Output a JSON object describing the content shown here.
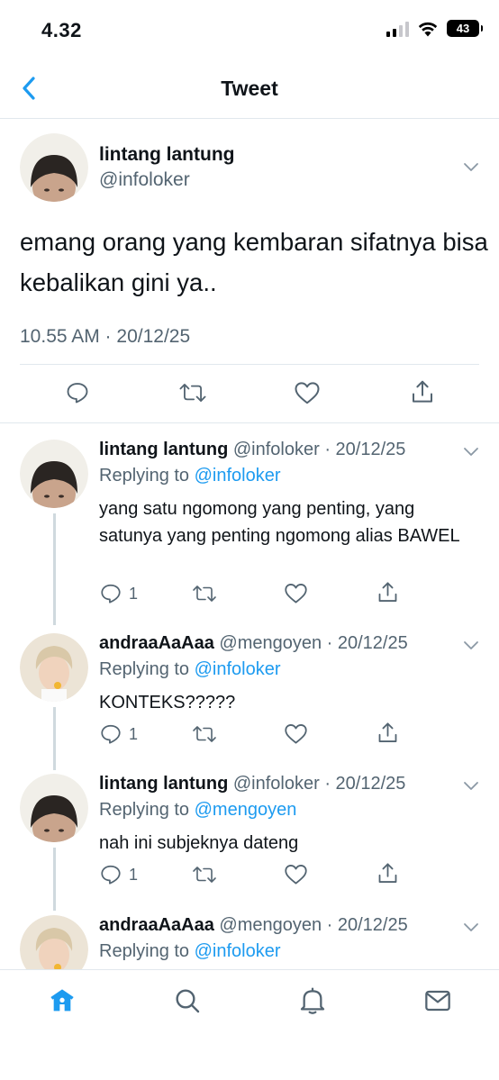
{
  "status_bar": {
    "time": "4.32",
    "battery": "43"
  },
  "header": {
    "title": "Tweet"
  },
  "main_tweet": {
    "name": "lintang lantung",
    "handle": "@infoloker",
    "text": "emang orang yang kembaran sifatnya bisa kebalikan gini ya..",
    "timestamp": "10.55 AM · 20/12/25"
  },
  "replies": [
    {
      "name": "lintang lantung",
      "meta": "@infoloker · 20/12/25",
      "replying_prefix": "Replying to ",
      "replying_to": "@infoloker",
      "text": "yang satu ngomong yang penting, yang satunya yang penting ngomong alias BAWEL",
      "reply_count": "1"
    },
    {
      "name": "andraaAaAaa",
      "meta": "@mengoyen · 20/12/25",
      "replying_prefix": "Replying to ",
      "replying_to": "@infoloker",
      "text": "KONTEKS?????",
      "reply_count": "1"
    },
    {
      "name": "lintang lantung",
      "meta": "@infoloker · 20/12/25",
      "replying_prefix": "Replying to ",
      "replying_to": "@mengoyen",
      "text": "nah ini subjeknya dateng",
      "reply_count": "1"
    },
    {
      "name": "andraaAaAaa",
      "meta": "@mengoyen · 20/12/25",
      "replying_prefix": "Replying to ",
      "replying_to": "@infoloker"
    }
  ],
  "tab_bar": {
    "items": [
      "home-icon",
      "search-icon",
      "notifications-icon",
      "messages-icon"
    ],
    "active": "home-icon"
  },
  "colors": {
    "accent": "#1d9bf0",
    "secondary_text": "#536471",
    "divider": "#e1e8ed"
  }
}
